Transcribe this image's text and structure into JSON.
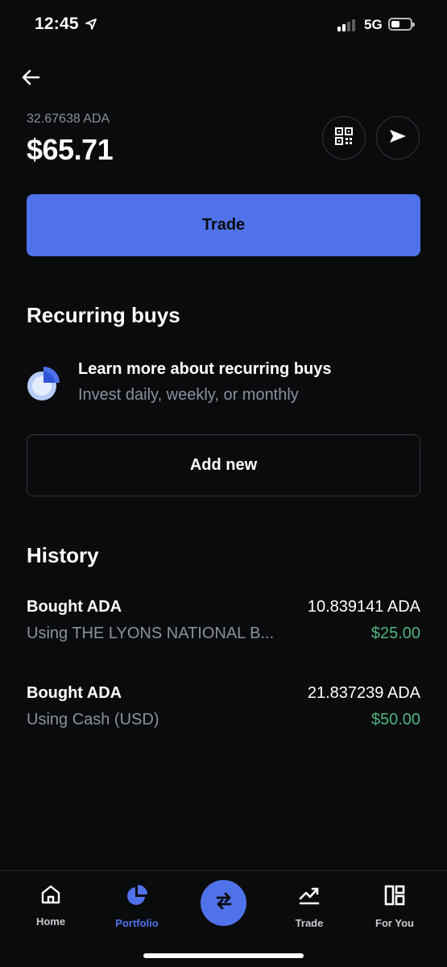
{
  "status_bar": {
    "time": "12:45",
    "network": "5G"
  },
  "asset": {
    "crypto_amount": "32.67638 ADA",
    "fiat_balance": "$65.71"
  },
  "actions": {
    "trade_label": "Trade"
  },
  "recurring": {
    "title": "Recurring buys",
    "learn_title": "Learn more about recurring buys",
    "learn_subtitle": "Invest daily, weekly, or monthly",
    "add_label": "Add new"
  },
  "history": {
    "title": "History",
    "items": [
      {
        "title": "Bought ADA",
        "subtitle": "Using THE LYONS NATIONAL B...",
        "crypto": "10.839141 ADA",
        "fiat": "$25.00"
      },
      {
        "title": "Bought ADA",
        "subtitle": "Using Cash (USD)",
        "crypto": "21.837239 ADA",
        "fiat": "$50.00"
      }
    ]
  },
  "nav": {
    "items": [
      {
        "label": "Home",
        "icon": "home-icon"
      },
      {
        "label": "Portfolio",
        "icon": "pie-chart-icon"
      },
      {
        "label": "Trade",
        "icon": "trend-chart-icon"
      },
      {
        "label": "For You",
        "icon": "layout-icon"
      }
    ],
    "active": "Portfolio"
  },
  "colors": {
    "accent": "#4f72ea",
    "positive": "#4fb47c",
    "background": "#0a0b0d",
    "muted": "#8a919e"
  }
}
